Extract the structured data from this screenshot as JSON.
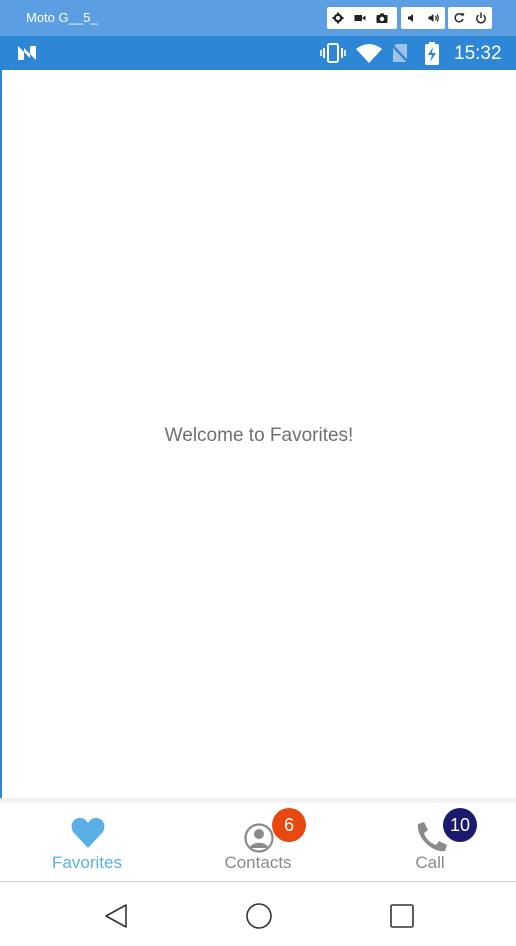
{
  "emulator": {
    "title": "Moto G__5_",
    "toolbar": [
      "settings-icon",
      "video-record-icon",
      "camera-icon",
      "volume-down-icon",
      "volume-up-icon",
      "rotate-icon",
      "power-icon"
    ]
  },
  "status_bar": {
    "time": "15:32",
    "icons": [
      "vibrate-icon",
      "wifi-icon",
      "no-sim-icon",
      "battery-charging-icon"
    ]
  },
  "main": {
    "welcome_text": "Welcome to Favorites!"
  },
  "tabs": [
    {
      "label": "Favorites",
      "icon": "heart-icon",
      "active": true,
      "badge": null
    },
    {
      "label": "Contacts",
      "icon": "person-icon",
      "active": false,
      "badge": "6"
    },
    {
      "label": "Call",
      "icon": "phone-icon",
      "active": false,
      "badge": "10"
    }
  ],
  "colors": {
    "status_bar": "#2e86d6",
    "active_tab": "#5aafe6",
    "inactive_tab": "#8a8a8a",
    "contacts_badge": "#e8490f",
    "call_badge": "#1a1a6e"
  },
  "nav_bar": [
    "back-button",
    "home-button",
    "recents-button"
  ]
}
